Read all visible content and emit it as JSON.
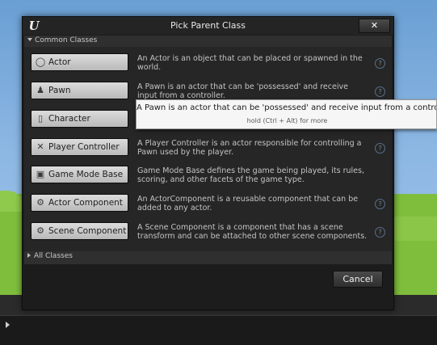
{
  "dialog": {
    "title": "Pick Parent Class",
    "close_label": "✕",
    "common_header": "Common Classes",
    "all_classes_label": "All Classes",
    "cancel_label": "Cancel"
  },
  "classes": [
    {
      "label": "Actor",
      "icon": "actor-icon",
      "description": "An Actor is an object that can be placed or spawned in the world."
    },
    {
      "label": "Pawn",
      "icon": "pawn-icon",
      "description": "A Pawn is an actor that can be 'possessed' and receive input from a controller."
    },
    {
      "label": "Character",
      "icon": "character-icon",
      "description": ""
    },
    {
      "label": "Player Controller",
      "icon": "player-controller-icon",
      "description": "A Player Controller is an actor responsible for controlling a Pawn used by the player."
    },
    {
      "label": "Game Mode Base",
      "icon": "game-mode-icon",
      "description": "Game Mode Base defines the game being played, its rules, scoring, and other facets of the game type."
    },
    {
      "label": "Actor Component",
      "icon": "actor-component-icon",
      "description": "An ActorComponent is a reusable component that can be added to any actor."
    },
    {
      "label": "Scene Component",
      "icon": "scene-component-icon",
      "description": "A Scene Component is a component that has a scene transform and can be attached to other scene components."
    }
  ],
  "tooltip": {
    "main": "A Pawn is an actor that can be 'possessed' and receive input from a controller.",
    "hint": "hold (Ctrl + Alt) for more"
  },
  "help_glyph": "?",
  "logo_glyph": "U"
}
